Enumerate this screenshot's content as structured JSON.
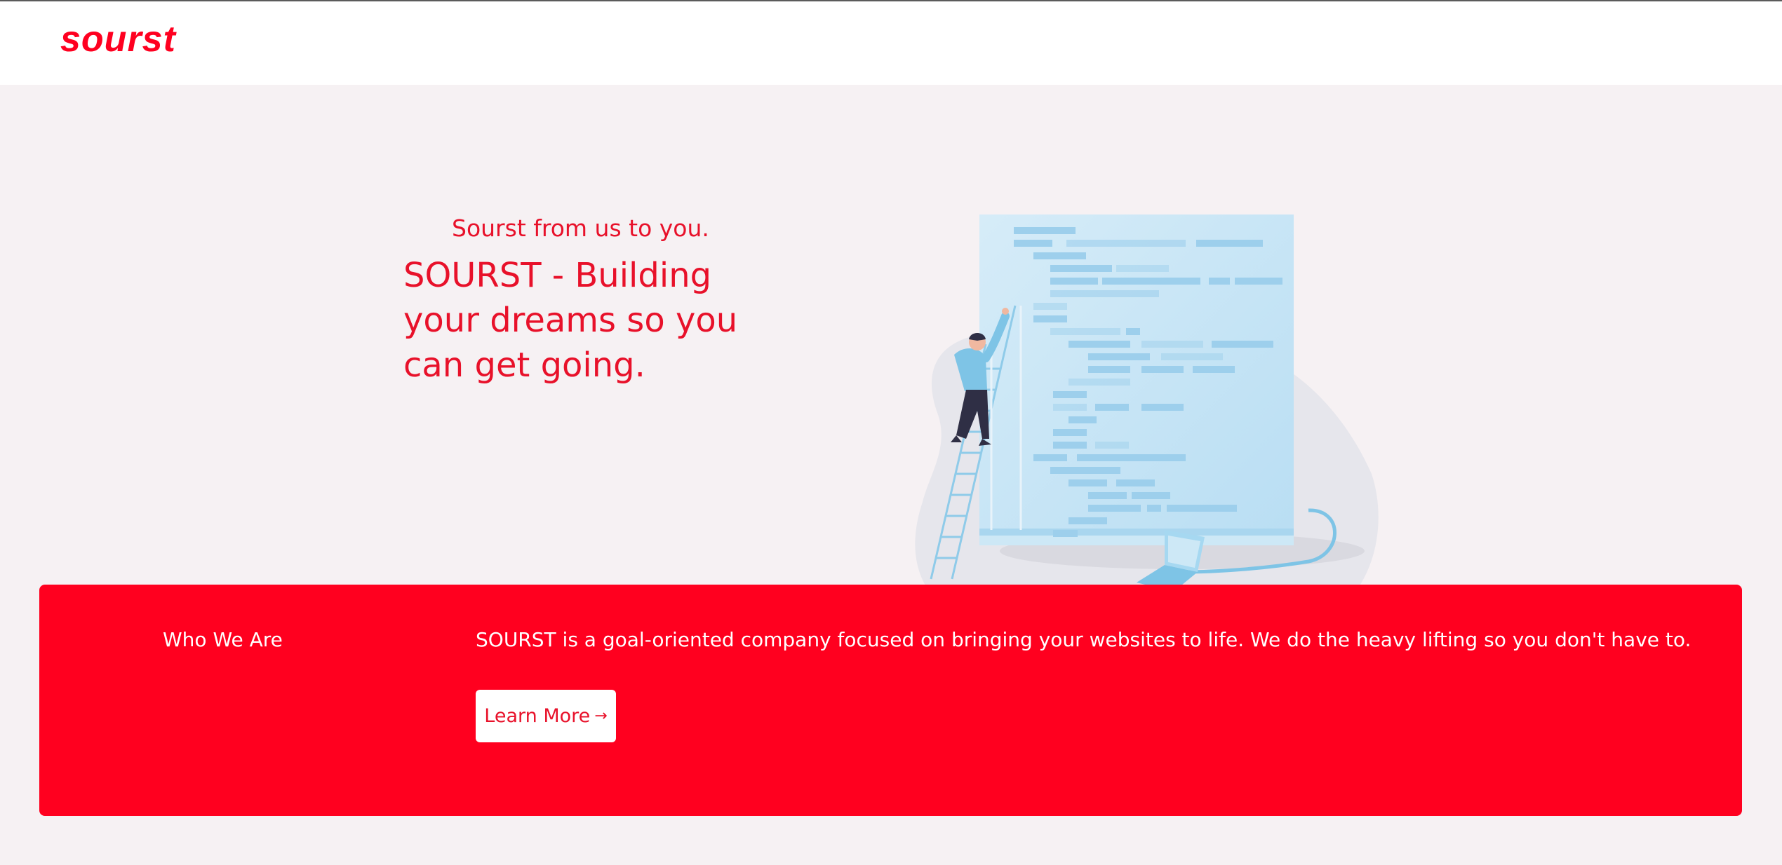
{
  "header": {
    "logo_text": "sourst"
  },
  "hero": {
    "tagline": "Sourst from us to you.",
    "headline": "SOURST - Building your dreams so you can get going.",
    "illustration": "person-climbing-ladder-code-illustration"
  },
  "who_we_are": {
    "title": "Who We Are",
    "description": "SOURST is a goal-oriented company focused on bringing your websites to life. We do the heavy lifting so you don't have to.",
    "button_label": "Learn More",
    "button_icon": "arrow-right-icon"
  },
  "colors": {
    "brand_red": "#ff001f",
    "page_background": "#f6f1f3",
    "header_background": "#ffffff"
  }
}
